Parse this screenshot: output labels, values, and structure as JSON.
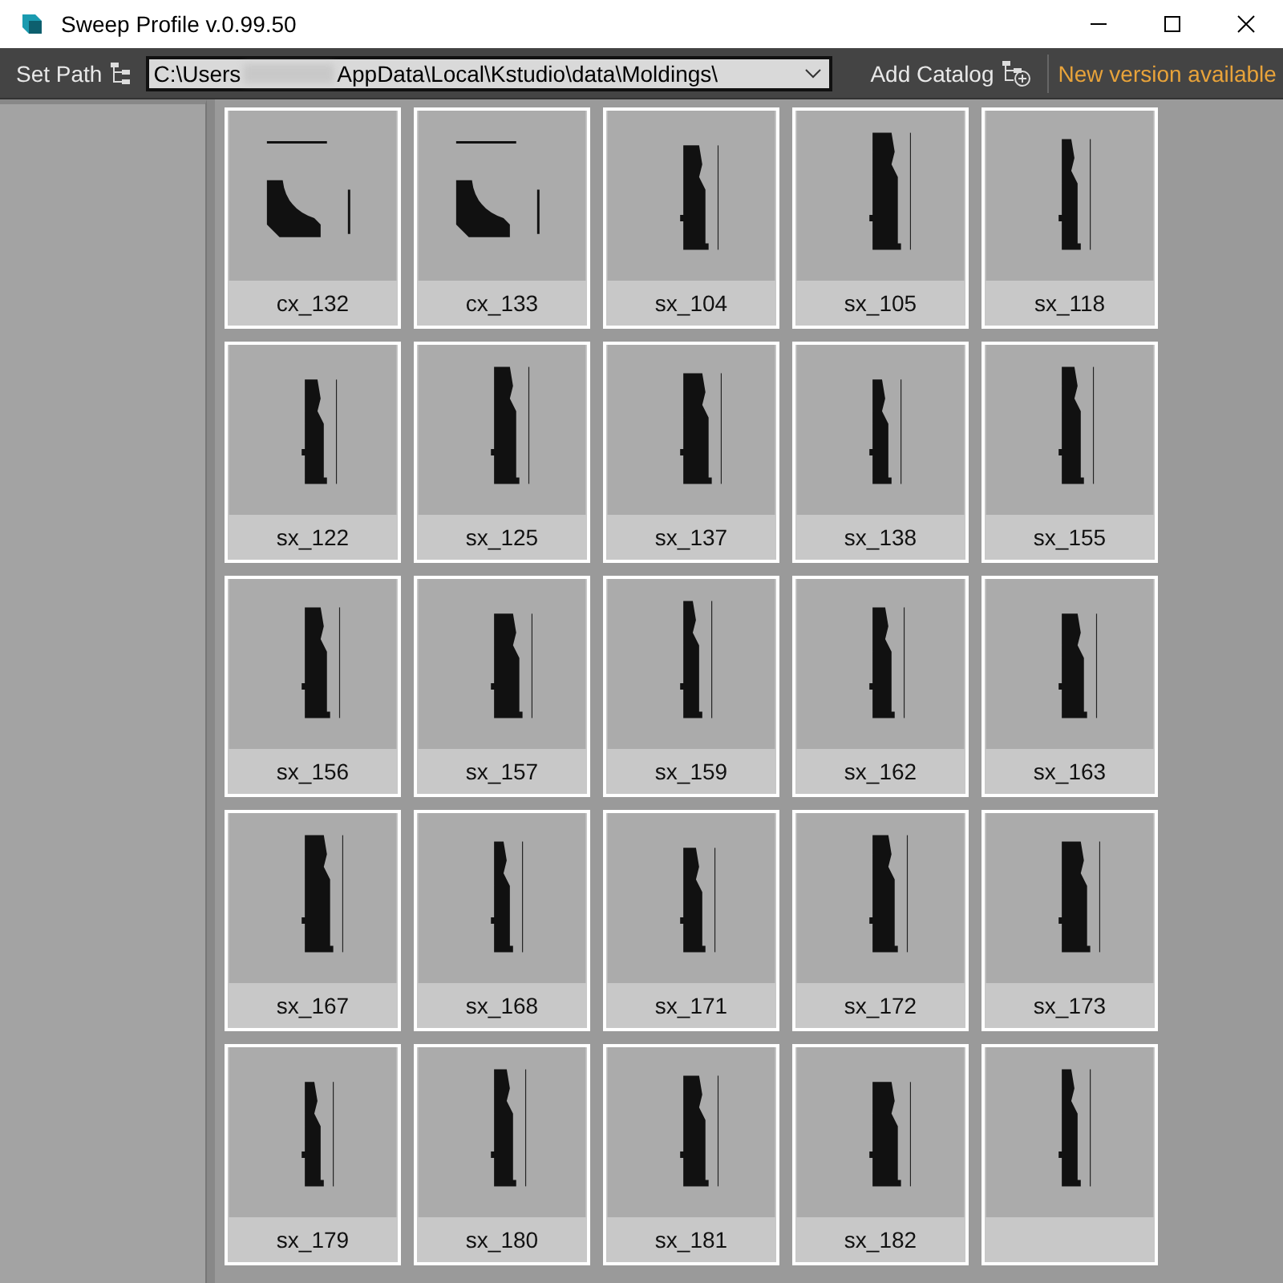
{
  "window": {
    "title": "Sweep Profile v.0.99.50"
  },
  "toolbar": {
    "set_path": "Set Path",
    "path_start": "C:\\Users",
    "path_end": "AppData\\Local\\Kstudio\\data\\Moldings\\",
    "add_catalog": "Add Catalog",
    "update_notice": "New version available"
  },
  "profiles": [
    {
      "label": "cx_132",
      "kind": "corner"
    },
    {
      "label": "cx_133",
      "kind": "corner"
    },
    {
      "label": "sx_104",
      "kind": "skirting"
    },
    {
      "label": "sx_105",
      "kind": "skirting"
    },
    {
      "label": "sx_118",
      "kind": "skirting"
    },
    {
      "label": "sx_122",
      "kind": "skirting"
    },
    {
      "label": "sx_125",
      "kind": "skirting"
    },
    {
      "label": "sx_137",
      "kind": "skirting"
    },
    {
      "label": "sx_138",
      "kind": "skirting"
    },
    {
      "label": "sx_155",
      "kind": "skirting"
    },
    {
      "label": "sx_156",
      "kind": "skirting"
    },
    {
      "label": "sx_157",
      "kind": "skirting"
    },
    {
      "label": "sx_159",
      "kind": "skirting"
    },
    {
      "label": "sx_162",
      "kind": "skirting"
    },
    {
      "label": "sx_163",
      "kind": "skirting"
    },
    {
      "label": "sx_167",
      "kind": "skirting"
    },
    {
      "label": "sx_168",
      "kind": "skirting"
    },
    {
      "label": "sx_171",
      "kind": "skirting"
    },
    {
      "label": "sx_172",
      "kind": "skirting"
    },
    {
      "label": "sx_173",
      "kind": "skirting"
    },
    {
      "label": "sx_179",
      "kind": "skirting"
    },
    {
      "label": "sx_180",
      "kind": "skirting"
    },
    {
      "label": "sx_181",
      "kind": "skirting"
    },
    {
      "label": "sx_182",
      "kind": "skirting"
    },
    {
      "kind": "skirting"
    }
  ]
}
